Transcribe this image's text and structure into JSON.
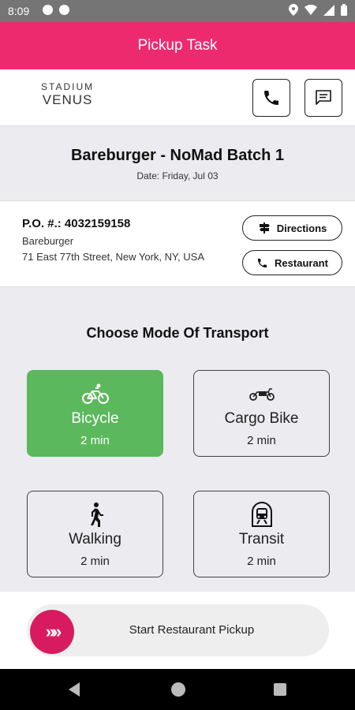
{
  "status_bar": {
    "time": "8:09"
  },
  "app_bar": {
    "title": "Pickup Task"
  },
  "brand": {
    "line1": "STADIUM",
    "line2": "VENUS"
  },
  "batch": {
    "title": "Bareburger - NoMad Batch 1",
    "date": "Date: Friday, Jul 03"
  },
  "order": {
    "po": "P.O. #.: 4032159158",
    "restaurant": "Bareburger",
    "address": "71 East 77th Street, New York, NY, USA",
    "directions_label": "Directions",
    "restaurant_label": "Restaurant"
  },
  "transport": {
    "title": "Choose Mode Of Transport",
    "modes": [
      {
        "label": "Bicycle",
        "time": "2 min",
        "icon": "bicycle-icon",
        "selected": true
      },
      {
        "label": "Cargo Bike",
        "time": "2 min",
        "icon": "cargo-bike-icon",
        "selected": false
      },
      {
        "label": "Walking",
        "time": "2 min",
        "icon": "walking-icon",
        "selected": false
      },
      {
        "label": "Transit",
        "time": "2 min",
        "icon": "transit-icon",
        "selected": false
      }
    ]
  },
  "slider": {
    "label": "Start Restaurant Pickup",
    "knob_glyph": "»»"
  },
  "colors": {
    "accent": "#ee2a6f",
    "selected": "#5cb85c",
    "knob": "#d81b60"
  }
}
